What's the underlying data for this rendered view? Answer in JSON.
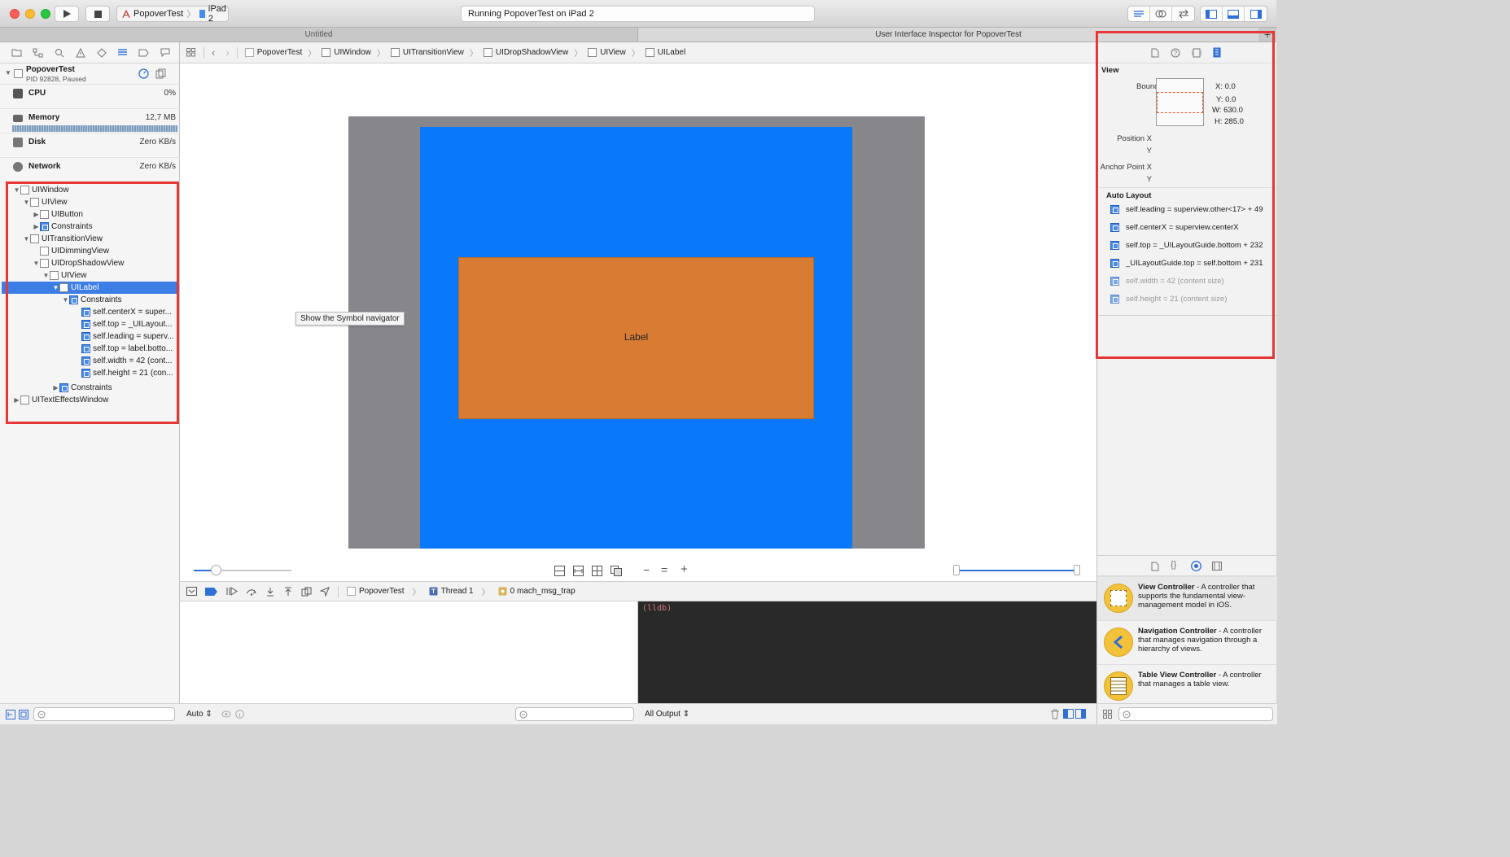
{
  "colors": {
    "selection": "#3d7ee6",
    "highlight": "#e63636",
    "uiview_blue": "#0a78fa",
    "label_orange": "#d97c33",
    "window_gray": "#86868b"
  },
  "toolbar": {
    "scheme_target": "PopoverTest",
    "scheme_device": "iPad 2",
    "activity_status": "Running PopoverTest on iPad 2",
    "icons": [
      "run-icon",
      "stop-icon",
      "standard-editor-icon",
      "assistant-editor-icon",
      "version-editor-icon",
      "navigator-toggle-icon",
      "debug-area-toggle-icon",
      "utilities-toggle-icon"
    ]
  },
  "tabs": [
    "Untitled",
    "User Interface Inspector for PopoverTest"
  ],
  "navigator": {
    "process_name": "PopoverTest",
    "process_status": "PID 92828, Paused",
    "gauges": [
      {
        "name": "CPU",
        "value": "0%"
      },
      {
        "name": "Memory",
        "value": "12,7 MB"
      },
      {
        "name": "Disk",
        "value": "Zero KB/s"
      },
      {
        "name": "Network",
        "value": "Zero KB/s"
      }
    ],
    "tree": [
      {
        "label": "UIWindow",
        "disc": "▼",
        "kind": "view"
      },
      {
        "label": "UIView",
        "disc": "▼",
        "kind": "view"
      },
      {
        "label": "UIButton",
        "disc": "▶",
        "kind": "view"
      },
      {
        "label": "Constraints",
        "disc": "▶",
        "kind": "constraint"
      },
      {
        "label": "UITransitionView",
        "disc": "▼",
        "kind": "view"
      },
      {
        "label": "UIDimmingView",
        "disc": "",
        "kind": "view"
      },
      {
        "label": "UIDropShadowView",
        "disc": "▼",
        "kind": "view"
      },
      {
        "label": "UIView",
        "disc": "▼",
        "kind": "view"
      },
      {
        "label": "UILabel",
        "disc": "▼",
        "kind": "view"
      },
      {
        "label": "Constraints",
        "disc": "▼",
        "kind": "constraint"
      },
      {
        "label": "self.centerX = super...",
        "disc": "",
        "kind": "constraint"
      },
      {
        "label": "self.top = _UILayout...",
        "disc": "",
        "kind": "constraint"
      },
      {
        "label": "self.leading = superv...",
        "disc": "",
        "kind": "constraint"
      },
      {
        "label": "self.top = label.botto...",
        "disc": "",
        "kind": "constraint"
      },
      {
        "label": "self.width = 42 (cont...",
        "disc": "",
        "kind": "constraint"
      },
      {
        "label": "self.height = 21 (con...",
        "disc": "",
        "kind": "constraint"
      },
      {
        "label": "Constraints",
        "disc": "▶",
        "kind": "constraint"
      },
      {
        "label": "UITextEffectsWindow",
        "disc": "▶",
        "kind": "view"
      }
    ]
  },
  "jumpbar": [
    "PopoverTest",
    "UIWindow",
    "UITransitionView",
    "UIDropShadowView",
    "UIView",
    "UILabel"
  ],
  "canvas": {
    "label_text": "Label",
    "tooltip": "Show the Symbol navigator"
  },
  "debug": {
    "crumbs": [
      "PopoverTest",
      "Thread 1",
      "0 mach_msg_trap"
    ],
    "console_prompt": "(lldb)",
    "variables_scope": "Auto",
    "output_scope": "All Output"
  },
  "inspector": {
    "section_view": "View",
    "bounds_label": "Bounds",
    "bounds": {
      "x": "X: 0.0",
      "y": "Y: 0.0",
      "w": "W: 630.0",
      "h": "H: 285.0"
    },
    "position_x_label": "Position X",
    "position_y_label": "Y",
    "anchor_x_label": "Anchor Point X",
    "anchor_y_label": "Y",
    "auto_layout_label": "Auto Layout",
    "constraints": [
      {
        "text": "self.leading = superview.other<17> + 49",
        "dim": false
      },
      {
        "text": "self.centerX = superview.centerX",
        "dim": false
      },
      {
        "text": "self.top = _UILayoutGuide.bottom + 232",
        "dim": false
      },
      {
        "text": "_UILayoutGuide.top = self.bottom + 231",
        "dim": false
      },
      {
        "text": "self.width = 42 (content size)",
        "dim": true
      },
      {
        "text": "self.height = 21 (content size)",
        "dim": true
      }
    ],
    "library": [
      {
        "title": "View Controller",
        "desc": " - A controller that supports the fundamental view-management model in iOS."
      },
      {
        "title": "Navigation Controller",
        "desc": " - A controller that manages navigation through a hierarchy of views."
      },
      {
        "title": "Table View Controller",
        "desc": " - A controller that manages a table view."
      }
    ]
  }
}
